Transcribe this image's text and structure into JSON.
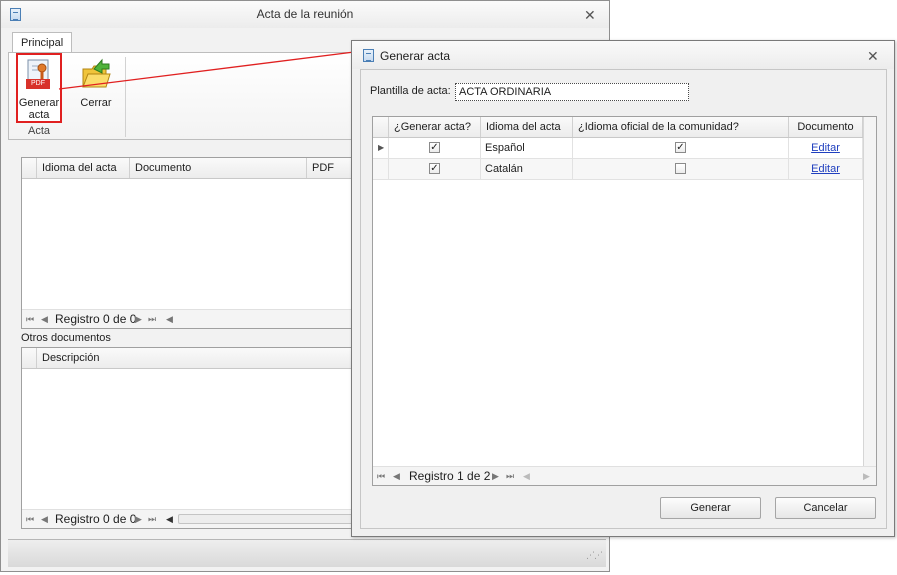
{
  "back_window": {
    "title": "Acta de la reunión",
    "close_glyph": "✕",
    "tab_principal": "Principal",
    "ribbon": {
      "btn_generar_line1": "Generar",
      "btn_generar_line2": "acta",
      "pdf_badge": "PDF",
      "btn_cerrar": "Cerrar",
      "group_label": "Acta",
      "collapse_glyph": "^"
    },
    "grid1": {
      "columns": [
        "Idioma del acta",
        "Documento",
        "PDF"
      ],
      "nav_text": "Registro 0 de 0"
    },
    "otros_label": "Otros documentos",
    "grid2": {
      "columns": [
        "Descripción"
      ],
      "nav_text": "Registro 0 de 0"
    }
  },
  "dialog": {
    "title": "Generar acta",
    "close_glyph": "✕",
    "plantilla_label": "Plantilla de acta:",
    "plantilla_value": "ACTA ORDINARIA",
    "grid": {
      "columns": [
        "¿Generar acta?",
        "Idioma del acta",
        "¿Idioma oficial de la comunidad?",
        "Documento"
      ],
      "rows": [
        {
          "generar": true,
          "idioma": "Español",
          "oficial": true,
          "documento": "Editar"
        },
        {
          "generar": true,
          "idioma": "Catalán",
          "oficial": false,
          "documento": "Editar"
        }
      ],
      "nav_text": "Registro 1 de 2"
    },
    "btn_generar": "Generar",
    "btn_cancelar": "Cancelar"
  },
  "colors": {
    "highlight_red": "#e02020",
    "link_blue": "#1f3fbf"
  }
}
